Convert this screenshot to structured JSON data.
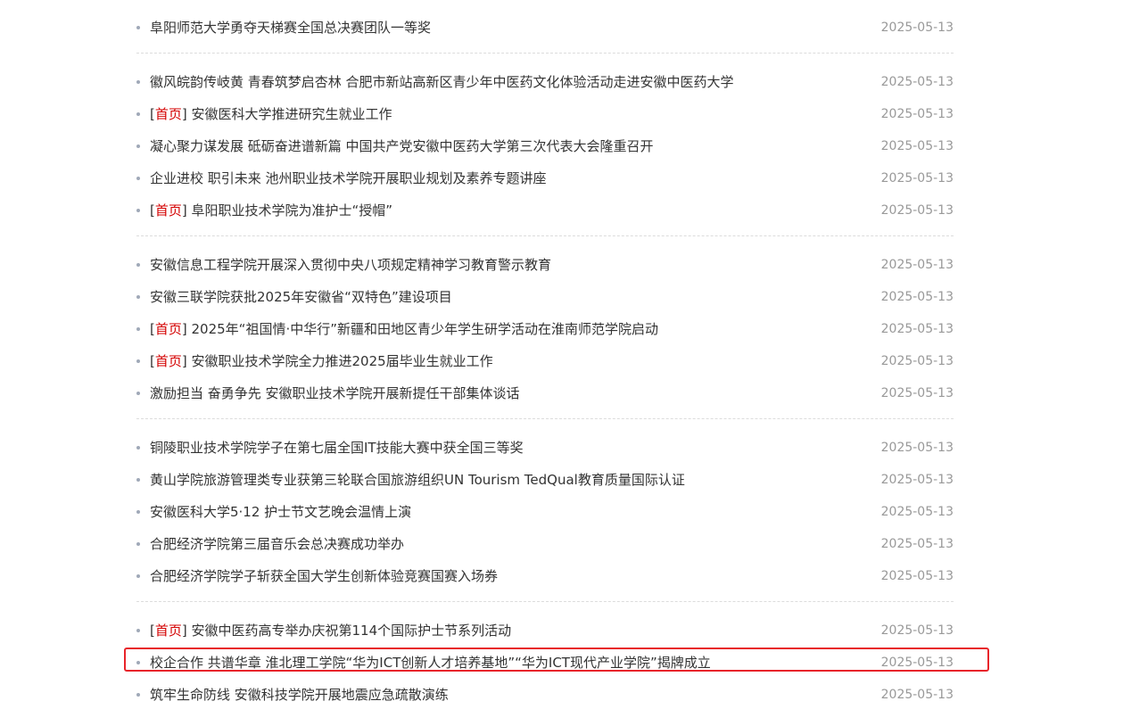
{
  "colors": {
    "text": "#333333",
    "date": "#999999",
    "tag": "#d40000",
    "highlight": "#e8242a",
    "divider": "#dcdcdc"
  },
  "tag_word": "首页",
  "groups": [
    [
      {
        "title": "阜阳师范大学勇夺天梯赛全国总决赛团队一等奖",
        "date": "2025-05-13",
        "tagged": false
      }
    ],
    [
      {
        "title": "徽风皖韵传岐黄 青春筑梦启杏林 合肥市新站高新区青少年中医药文化体验活动走进安徽中医药大学",
        "date": "2025-05-13",
        "tagged": false
      },
      {
        "title": "安徽医科大学推进研究生就业工作",
        "date": "2025-05-13",
        "tagged": true
      },
      {
        "title": "凝心聚力谋发展 砥砺奋进谱新篇 中国共产党安徽中医药大学第三次代表大会隆重召开",
        "date": "2025-05-13",
        "tagged": false
      },
      {
        "title": "企业进校 职引未来 池州职业技术学院开展职业规划及素养专题讲座",
        "date": "2025-05-13",
        "tagged": false
      },
      {
        "title": "阜阳职业技术学院为准护士“授帽”",
        "date": "2025-05-13",
        "tagged": true
      }
    ],
    [
      {
        "title": "安徽信息工程学院开展深入贯彻中央八项规定精神学习教育警示教育",
        "date": "2025-05-13",
        "tagged": false
      },
      {
        "title": "安徽三联学院获批2025年安徽省“双特色”建设项目",
        "date": "2025-05-13",
        "tagged": false
      },
      {
        "title": "2025年“祖国情·中华行”新疆和田地区青少年学生研学活动在淮南师范学院启动",
        "date": "2025-05-13",
        "tagged": true
      },
      {
        "title": "安徽职业技术学院全力推进2025届毕业生就业工作",
        "date": "2025-05-13",
        "tagged": true
      },
      {
        "title": "激励担当 奋勇争先 安徽职业技术学院开展新提任干部集体谈话",
        "date": "2025-05-13",
        "tagged": false
      }
    ],
    [
      {
        "title": "铜陵职业技术学院学子在第七届全国IT技能大赛中获全国三等奖",
        "date": "2025-05-13",
        "tagged": false
      },
      {
        "title": "黄山学院旅游管理类专业获第三轮联合国旅游组织UN Tourism TedQual教育质量国际认证",
        "date": "2025-05-13",
        "tagged": false
      },
      {
        "title": "安徽医科大学5·12 护士节文艺晚会温情上演",
        "date": "2025-05-13",
        "tagged": false
      },
      {
        "title": "合肥经济学院第三届音乐会总决赛成功举办",
        "date": "2025-05-13",
        "tagged": false
      },
      {
        "title": "合肥经济学院学子斩获全国大学生创新体验竞赛国赛入场券",
        "date": "2025-05-13",
        "tagged": false
      }
    ],
    [
      {
        "title": "安徽中医药高专举办庆祝第114个国际护士节系列活动",
        "date": "2025-05-13",
        "tagged": true
      },
      {
        "title": "校企合作 共谱华章 淮北理工学院“华为ICT创新人才培养基地”“华为ICT现代产业学院”揭牌成立",
        "date": "2025-05-13",
        "tagged": false,
        "highlighted": true
      },
      {
        "title": "筑牢生命防线 安徽科技学院开展地震应急疏散演练",
        "date": "2025-05-13",
        "tagged": false
      }
    ]
  ]
}
